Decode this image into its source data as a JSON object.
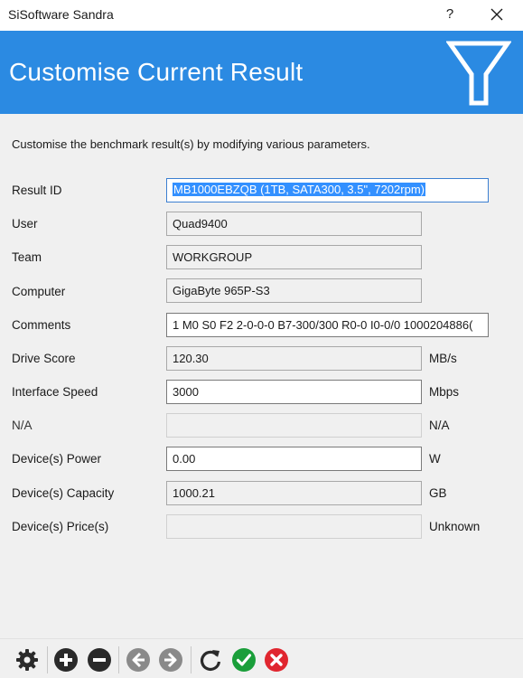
{
  "window": {
    "title": "SiSoftware Sandra",
    "help_label": "?"
  },
  "header": {
    "title": "Customise Current Result"
  },
  "description": "Customise the benchmark result(s) by modifying various parameters.",
  "form": {
    "result_id": {
      "label": "Result ID",
      "value": "MB1000EBZQB (1TB, SATA300, 3.5\", 7202rpm)"
    },
    "user": {
      "label": "User",
      "value": "Quad9400"
    },
    "team": {
      "label": "Team",
      "value": "WORKGROUP"
    },
    "computer": {
      "label": "Computer",
      "value": "GigaByte 965P-S3"
    },
    "comments": {
      "label": "Comments",
      "value": "1 M0 S0 F2 2-0-0-0 B7-300/300 R0-0 I0-0/0 1000204886("
    },
    "drive_score": {
      "label": "Drive Score",
      "value": "120.30",
      "unit": "MB/s"
    },
    "interface_speed": {
      "label": "Interface Speed",
      "value": "3000",
      "unit": "Mbps"
    },
    "na_row": {
      "label": "N/A",
      "value": "",
      "unit": "N/A"
    },
    "device_power": {
      "label": "Device(s) Power",
      "value": "0.00",
      "unit": "W"
    },
    "device_capacity": {
      "label": "Device(s) Capacity",
      "value": "1000.21",
      "unit": "GB"
    },
    "device_price": {
      "label": "Device(s) Price(s)",
      "value": "",
      "unit": "Unknown"
    }
  },
  "toolbar": {
    "icons": [
      "gear-icon",
      "add-icon",
      "remove-icon",
      "back-icon",
      "forward-icon",
      "refresh-icon",
      "ok-icon",
      "cancel-icon"
    ]
  },
  "colors": {
    "header": "#2b8ae2",
    "ok": "#1a9e3a",
    "cancel": "#e0262f",
    "nav_disabled": "#8a8a8a"
  }
}
